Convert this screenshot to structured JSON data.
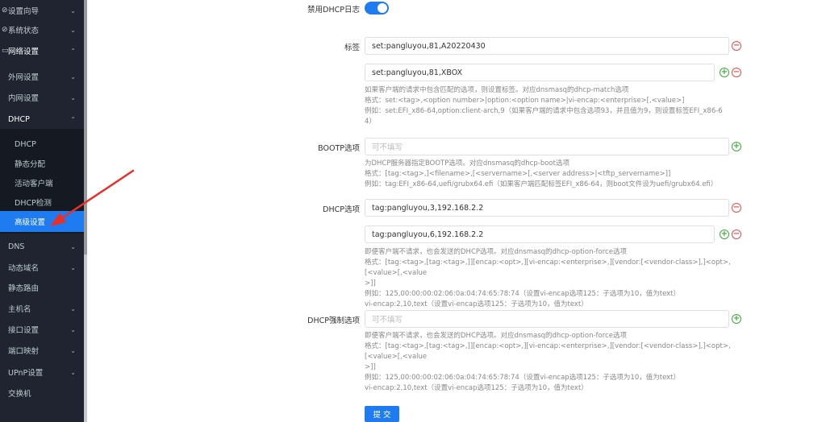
{
  "sidebar": {
    "items": [
      {
        "label": "设置向导"
      },
      {
        "label": "系统状态"
      },
      {
        "label": "网络设置"
      },
      {
        "label": "外网设置"
      },
      {
        "label": "内网设置"
      },
      {
        "label": "DHCP"
      },
      {
        "label": "DHCP"
      },
      {
        "label": "静态分配"
      },
      {
        "label": "活动客户端"
      },
      {
        "label": "DHCP检测"
      },
      {
        "label": "高级设置"
      },
      {
        "label": "DNS"
      },
      {
        "label": "动态域名"
      },
      {
        "label": "静态路由"
      },
      {
        "label": "主机名"
      },
      {
        "label": "接口设置"
      },
      {
        "label": "端口映射"
      },
      {
        "label": "UPnP设置"
      },
      {
        "label": "交换机"
      }
    ]
  },
  "form": {
    "log_label": "禁用DHCP日志",
    "tag_label": "标签",
    "tag_values": [
      "set:pangluyou,81,A20220430",
      "set:pangluyou,81,XBOX"
    ],
    "tag_help": [
      "如果客户端的请求中包含匹配的选项，则设置标签。对应dnsmasq的dhcp-match选项",
      "格式：set:<tag>,<option number>|option:<option name>|vi-encap:<enterprise>[,<value>]",
      "例如：set:EFI_x86-64,option:client-arch,9（如果客户端的请求中包含选项93，并且值为9，则设置标签EFI_x86-6",
      "4）"
    ],
    "bootp_label": "BOOTP选项",
    "bootp_placeholder": "可不填写",
    "bootp_help": [
      "为DHCP服务器指定BOOTP选项。对应dnsmasq的dhcp-boot选项",
      "格式：[tag:<tag>,]<filename>,[<servername>[,<server address>|<tftp_servername>]]",
      "例如：tag:EFI_x86-64,uefi/grubx64.efi（如果客户端匹配标签EFI_x86-64，则boot文件设为uefi/grubx64.efi）"
    ],
    "dhcp_label": "DHCP选项",
    "dhcp_values": [
      "tag:pangluyou,3,192.168.2.2",
      "tag:pangluyou,6,192.168.2.2"
    ],
    "dhcp_help": [
      "即便客户端不请求，也会发送的DHCP选项。对应dnsmasq的dhcp-option-force选项",
      "格式：[tag:<tag>,[tag:<tag>,]][encap:<opt>,][vi-encap:<enterprise>,][vendor:[<vendor-class>],]<opt>,[<value>[,<value",
      ">]]",
      "例如：125,00:00:00:02:06:0a:04:74:65:78:74（设置vi-encap选项125：子选项为10，值为text）",
      "vi-encap:2,10,text（设置vi-encap选项125：子选项为10，值为text）"
    ],
    "force_label": "DHCP强制选项",
    "force_placeholder": "可不填写",
    "force_help": [
      "即便客户端不请求，也会发送的DHCP选项。对应dnsmasq的dhcp-option-force选项",
      "格式：[tag:<tag>,[tag:<tag>,]][encap:<opt>,][vi-encap:<enterprise>,][vendor:[<vendor-class>],]<opt>,[<value>[,<value",
      ">]]",
      "例如：125,00:00:00:02:06:0a:04:74:65:78:74（设置vi-encap选项125：子选项为10，值为text）",
      "vi-encap:2,10,text（设置vi-encap选项125：子选项为10，值为text）"
    ],
    "submit_label": "提 交"
  },
  "colors": {
    "accent": "#1e7cf0",
    "sidebar": "#1f2430",
    "annotation": "#e8302a"
  }
}
